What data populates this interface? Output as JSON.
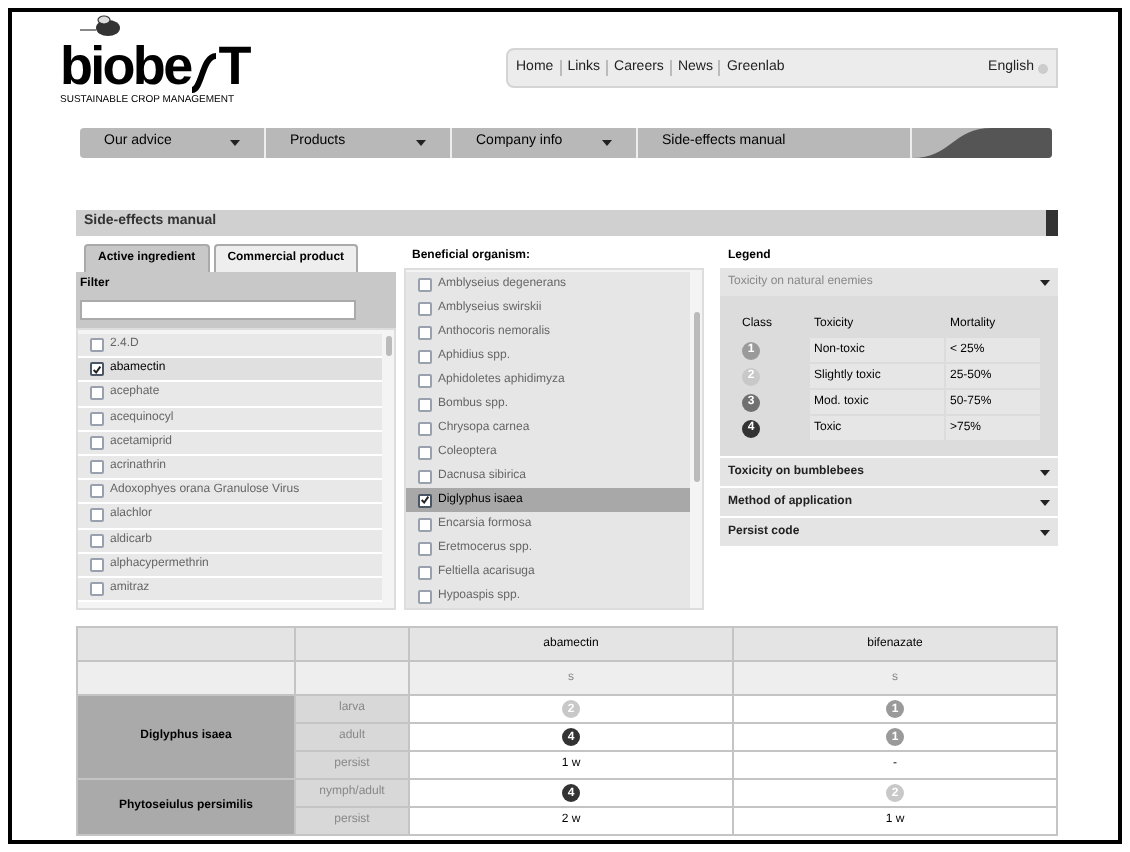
{
  "logo": {
    "wordmark": "biobe",
    "wordmark_end": "T",
    "tagline": "SUSTAINABLE CROP MANAGEMENT"
  },
  "top_links": [
    "Home",
    "Links",
    "Careers",
    "News",
    "Greenlab"
  ],
  "language": "English",
  "main_nav": [
    {
      "label": "Our advice",
      "has_menu": true
    },
    {
      "label": "Products",
      "has_menu": true
    },
    {
      "label": "Company info",
      "has_menu": true
    },
    {
      "label": "Side-effects manual",
      "has_menu": false
    }
  ],
  "section_title": "Side-effects manual",
  "tabs": [
    {
      "label": "Active ingredient",
      "selected": true
    },
    {
      "label": "Commercial product",
      "selected": false
    }
  ],
  "filter": {
    "label": "Filter"
  },
  "ingredients": [
    {
      "label": "2.4.D",
      "checked": false
    },
    {
      "label": "abamectin",
      "checked": true
    },
    {
      "label": "acephate",
      "checked": false
    },
    {
      "label": "acequinocyl",
      "checked": false
    },
    {
      "label": "acetamiprid",
      "checked": false
    },
    {
      "label": "acrinathrin",
      "checked": false
    },
    {
      "label": "Adoxophyes orana Granulose Virus",
      "checked": false
    },
    {
      "label": "alachlor",
      "checked": false
    },
    {
      "label": "aldicarb",
      "checked": false
    },
    {
      "label": "alphacypermethrin",
      "checked": false
    },
    {
      "label": "amitraz",
      "checked": false
    }
  ],
  "organisms": {
    "label": "Beneficial organism:",
    "items": [
      {
        "label": "Amblyseius degenerans",
        "checked": false
      },
      {
        "label": "Amblyseius swirskii",
        "checked": false
      },
      {
        "label": "Anthocoris nemoralis",
        "checked": false
      },
      {
        "label": "Aphidius spp.",
        "checked": false
      },
      {
        "label": "Aphidoletes aphidimyza",
        "checked": false
      },
      {
        "label": "Bombus spp.",
        "checked": false
      },
      {
        "label": "Chrysopa carnea",
        "checked": false
      },
      {
        "label": "Coleoptera",
        "checked": false
      },
      {
        "label": "Dacnusa sibirica",
        "checked": false
      },
      {
        "label": "Diglyphus isaea",
        "checked": true
      },
      {
        "label": "Encarsia formosa",
        "checked": false
      },
      {
        "label": "Eretmocerus spp.",
        "checked": false
      },
      {
        "label": "Feltiella acarisuga",
        "checked": false
      },
      {
        "label": "Hypoaspis spp.",
        "checked": false
      }
    ]
  },
  "legend": {
    "title": "Legend",
    "sections": [
      {
        "title": "Toxicity on natural enemies",
        "expanded": true,
        "columns": [
          "Class",
          "Toxicity",
          "Mortality"
        ],
        "rows": [
          {
            "class": "1",
            "color": "#9a9a9a",
            "toxicity": "Non-toxic",
            "mortality": "< 25%"
          },
          {
            "class": "2",
            "color": "#c8c8c8",
            "toxicity": "Slightly toxic",
            "mortality": "25-50%"
          },
          {
            "class": "3",
            "color": "#707070",
            "toxicity": "Mod. toxic",
            "mortality": "50-75%"
          },
          {
            "class": "4",
            "color": "#333333",
            "toxicity": "Toxic",
            "mortality": ">75%"
          }
        ]
      },
      {
        "title": "Toxicity on bumblebees",
        "expanded": false
      },
      {
        "title": "Method of application",
        "expanded": false
      },
      {
        "title": "Persist code",
        "expanded": false
      }
    ]
  },
  "results": {
    "columns": [
      "abamectin",
      "bifenazate"
    ],
    "subheader": [
      "s",
      "s"
    ],
    "groups": [
      {
        "organism": "Diglyphus isaea",
        "rows": [
          {
            "stage": "larva",
            "cells": [
              {
                "kind": "badge",
                "text": "2",
                "color": "#c8c8c8"
              },
              {
                "kind": "badge",
                "text": "1",
                "color": "#9a9a9a"
              }
            ]
          },
          {
            "stage": "adult",
            "cells": [
              {
                "kind": "badge",
                "text": "4",
                "color": "#333333"
              },
              {
                "kind": "badge",
                "text": "1",
                "color": "#9a9a9a"
              }
            ]
          },
          {
            "stage": "persist",
            "cells": [
              {
                "kind": "text",
                "text": "1 w"
              },
              {
                "kind": "text",
                "text": "-"
              }
            ]
          }
        ]
      },
      {
        "organism": "Phytoseiulus persimilis",
        "rows": [
          {
            "stage": "nymph/adult",
            "cells": [
              {
                "kind": "badge",
                "text": "4",
                "color": "#333333"
              },
              {
                "kind": "badge",
                "text": "2",
                "color": "#c8c8c8"
              }
            ]
          },
          {
            "stage": "persist",
            "cells": [
              {
                "kind": "text",
                "text": "2 w"
              },
              {
                "kind": "text",
                "text": "1 w"
              }
            ]
          }
        ]
      }
    ]
  }
}
